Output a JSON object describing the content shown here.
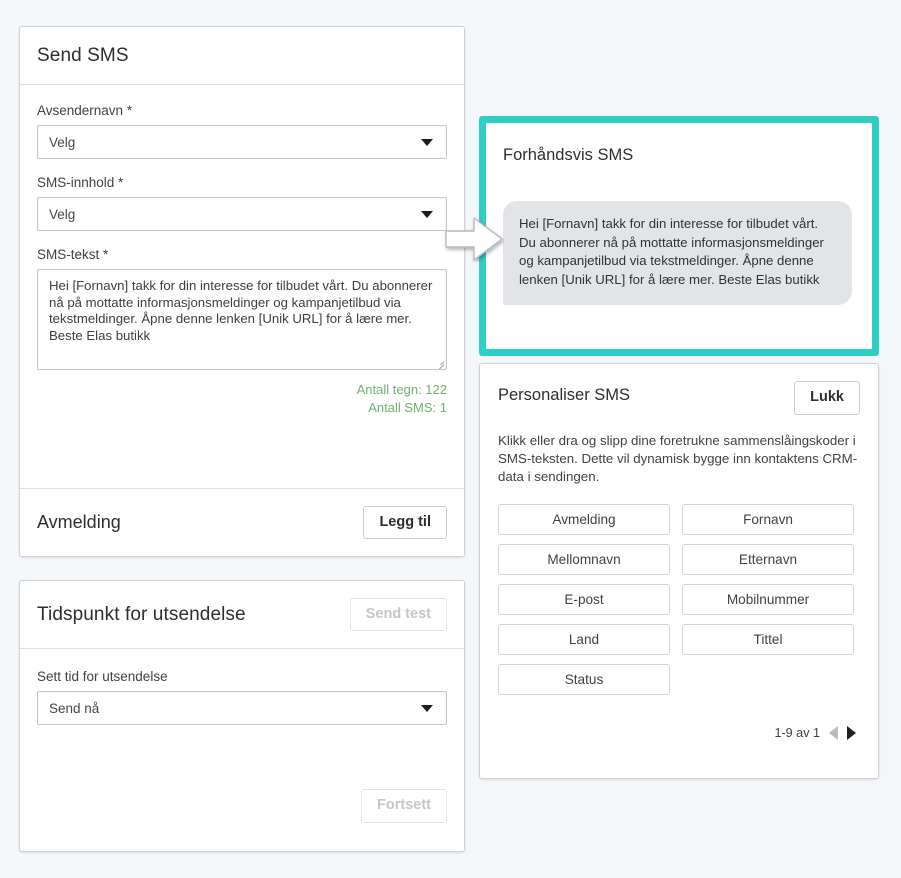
{
  "theme": {
    "page_bg": "#f4f7f9",
    "accent_teal": "#2ecfc4",
    "counter_green": "#6fb26b",
    "card_border": "#cfd3d8"
  },
  "send_sms_card": {
    "title": "Send SMS",
    "sender_label": "Avsendernavn *",
    "sender_value": "Velg",
    "content_label": "SMS-innhold *",
    "content_value": "Velg",
    "text_label": "SMS-tekst *",
    "text_value": "Hei [Fornavn] takk for din interesse for tilbudet vårt. Du abonnerer nå på mottatte informasjonsmeldinger og kampanjetilbud via tekstmeldinger. Åpne denne lenken [Unik URL] for å lære mer. Beste Elas butikk",
    "char_count": "Antall tegn: 122",
    "sms_count": "Antall SMS: 1",
    "unsubscribe_label": "Avmelding",
    "add_button": "Legg til"
  },
  "schedule_card": {
    "title": "Tidspunkt for utsendelse",
    "send_test_button": "Send test",
    "time_label": "Sett tid for utsendelse",
    "time_value": "Send nå",
    "continue_button": "Fortsett"
  },
  "preview_panel": {
    "title": "Forhåndsvis SMS",
    "message": "Hei [Fornavn] takk for din interesse for tilbudet vårt. Du abonnerer nå på mottatte informasjonsmeldinger og kampanjetilbud via tekstmeldinger. Åpne denne lenken [Unik URL] for å lære mer. Beste Elas butikk"
  },
  "personalize_panel": {
    "title": "Personaliser SMS",
    "close_button": "Lukk",
    "description": "Klikk eller dra og slipp dine foretrukne sammenslåingskoder i SMS-teksten. Dette vil dynamisk bygge inn kontaktens CRM-data i sendingen.",
    "merge_codes": [
      "Avmelding",
      "Fornavn",
      "Mellomnavn",
      "Etternavn",
      "E-post",
      "Mobilnummer",
      "Land",
      "Tittel",
      "Status"
    ],
    "pagination_label": "1-9 av 1"
  },
  "icons": {
    "caret_down": "chevron-down-icon",
    "pointer": "arrow-right-pointer-icon",
    "prev": "triangle-left-icon",
    "next": "triangle-right-icon",
    "resize": "resize-grip-icon"
  }
}
